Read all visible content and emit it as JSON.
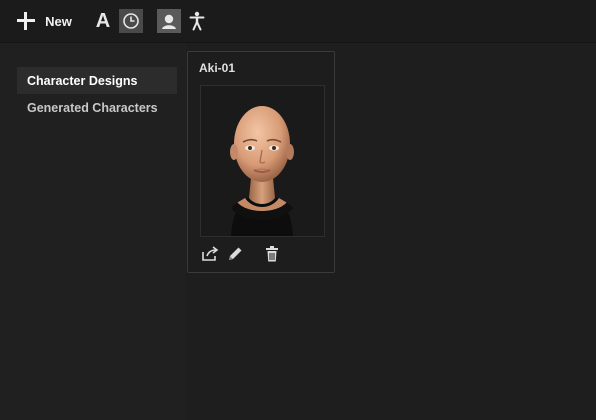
{
  "toolbar": {
    "new_label": "New",
    "text_icon_glyph": "A",
    "icons": [
      "plus-icon",
      "text-icon",
      "clock-icon",
      "face-icon",
      "accessibility-icon"
    ]
  },
  "sidebar": {
    "items": [
      {
        "label": "Character Designs",
        "active": true
      },
      {
        "label": "Generated Characters",
        "active": false
      }
    ]
  },
  "cards": [
    {
      "title": "Aki-01",
      "actions": [
        "share-icon",
        "edit-icon",
        "delete-icon"
      ]
    }
  ],
  "colors": {
    "background": "#1f1f1f",
    "toolbar": "#1b1b1b",
    "active_item": "#2c2c2c",
    "skin": "#d8a07c"
  }
}
